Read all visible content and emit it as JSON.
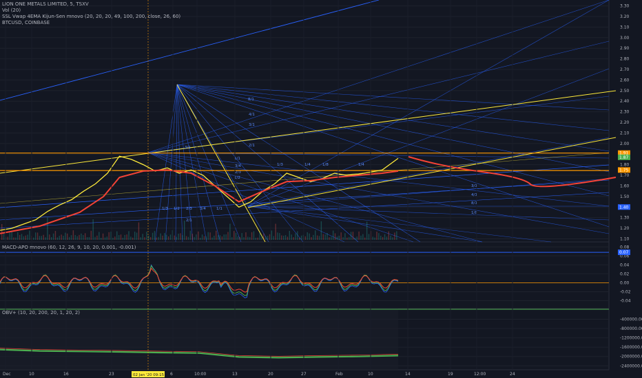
{
  "legend": {
    "main_title": "LION ONE METALS LIMITED, 5, TSXV",
    "vol": "Vol (20)",
    "ssl": "SSL Vwap 4EMA Kijun-Sen mnovo (20, 20, 20, 49, 100, 200, close, 26, 60)",
    "overlay": "BTCUSD, COINBASE",
    "macd": "MACD-APO mnovo (60, 12, 26, 9, 10, 20, 0.001, -0.001)",
    "obv": "OBV+ (10, 20, 200, 20, 1, 20, 2)"
  },
  "colors": {
    "background": "#131722",
    "price": "#ffeb3b",
    "ma": "#f44336",
    "fan": "#2962ff",
    "horizontal": "#ff9800",
    "macd_pos": "#4caf50",
    "macd_neg": "#f44336",
    "obv": "#4caf50"
  },
  "chart_data": [
    {
      "type": "line",
      "pane": "price",
      "y_ticks": [
        "3.30",
        "3.20",
        "3.10",
        "3.00",
        "2.90",
        "2.80",
        "2.70",
        "2.60",
        "2.50",
        "2.40",
        "2.30",
        "2.20",
        "2.10",
        "2.00",
        "1.90",
        "1.80",
        "1.70",
        "1.60",
        "1.50",
        "1.40",
        "1.30",
        "1.20",
        "1.10"
      ],
      "ylim": [
        1.09,
        3.33
      ],
      "price_tags": [
        {
          "label": "1.91",
          "value": 1.91,
          "color": "#ff9800"
        },
        {
          "label": "1.87",
          "value": 1.87,
          "color": "#4caf50"
        },
        {
          "label": "1.75",
          "value": 1.75,
          "color": "#ff9800"
        },
        {
          "label": "1.40",
          "value": 1.4,
          "color": "#2962ff"
        }
      ],
      "horizontal_levels": [
        1.91,
        1.745
      ],
      "fan_labels": [
        "8/1",
        "4/1",
        "3/1",
        "2/1",
        "3/1",
        "1/1",
        "3/4",
        "2/3",
        "1/2",
        "1/3",
        "1/4",
        "1/8",
        "1/4",
        "1/3",
        "1/2",
        "2/3",
        "3/4",
        "1/1",
        "2/1",
        "3/1",
        "4/1",
        "8/1",
        "1/8"
      ],
      "series": [
        {
          "name": "price",
          "x": [
            0,
            3,
            6,
            9,
            12,
            15,
            18,
            21,
            24,
            27,
            30,
            33,
            36,
            39,
            42,
            45,
            48,
            51,
            54,
            57,
            60,
            63,
            66,
            69,
            72,
            75,
            78,
            81,
            84,
            87,
            90,
            93,
            96,
            100
          ],
          "y": [
            1.18,
            1.2,
            1.24,
            1.28,
            1.36,
            1.42,
            1.47,
            1.55,
            1.62,
            1.72,
            1.88,
            1.85,
            1.8,
            1.74,
            1.77,
            1.72,
            1.75,
            1.7,
            1.6,
            1.5,
            1.4,
            1.45,
            1.55,
            1.62,
            1.72,
            1.68,
            1.64,
            1.67,
            1.72,
            1.7,
            1.71,
            1.73,
            1.75,
            1.86
          ]
        },
        {
          "name": "ma",
          "x": [
            0,
            10,
            20,
            26,
            30,
            36,
            42,
            48,
            54,
            60,
            66,
            72,
            78,
            84,
            90,
            96,
            100
          ],
          "y": [
            1.15,
            1.22,
            1.35,
            1.5,
            1.68,
            1.74,
            1.75,
            1.72,
            1.6,
            1.45,
            1.55,
            1.64,
            1.65,
            1.68,
            1.7,
            1.72,
            1.74
          ]
        }
      ]
    },
    {
      "type": "bar",
      "pane": "macd",
      "y_ticks": [
        "0.08",
        "0.06",
        "0.04",
        "0.02",
        "0.00",
        "-0.02",
        "-0.04"
      ],
      "ylim": [
        -0.05,
        0.085
      ],
      "zero_line": 0.0,
      "upper_line": 0.068,
      "tag": {
        "label": "0.07",
        "value": 0.068
      }
    },
    {
      "type": "line",
      "pane": "obv",
      "y_ticks": [
        "-400000.00",
        "-800000.00",
        "-1200000.00",
        "-1600000.00",
        "-2000000.00",
        "-2400000.00"
      ],
      "ylim": [
        -2450000,
        -150000
      ],
      "series": [
        {
          "name": "obv",
          "x": [
            0,
            10,
            20,
            30,
            40,
            50,
            60,
            70,
            80,
            90,
            100
          ],
          "y": [
            -1700000,
            -1760000,
            -1780000,
            -1800000,
            -1830000,
            -1850000,
            -2020000,
            -2050000,
            -2020000,
            -2000000,
            -1960000
          ]
        }
      ]
    }
  ],
  "x_ticks": [
    "Dec",
    "10",
    "16",
    "23",
    "6",
    "10:00",
    "13",
    "20",
    "27",
    "Feb",
    "10",
    "14",
    "19",
    "12:00",
    "24"
  ],
  "crosshair_label": "02 Jan '20  09:15"
}
